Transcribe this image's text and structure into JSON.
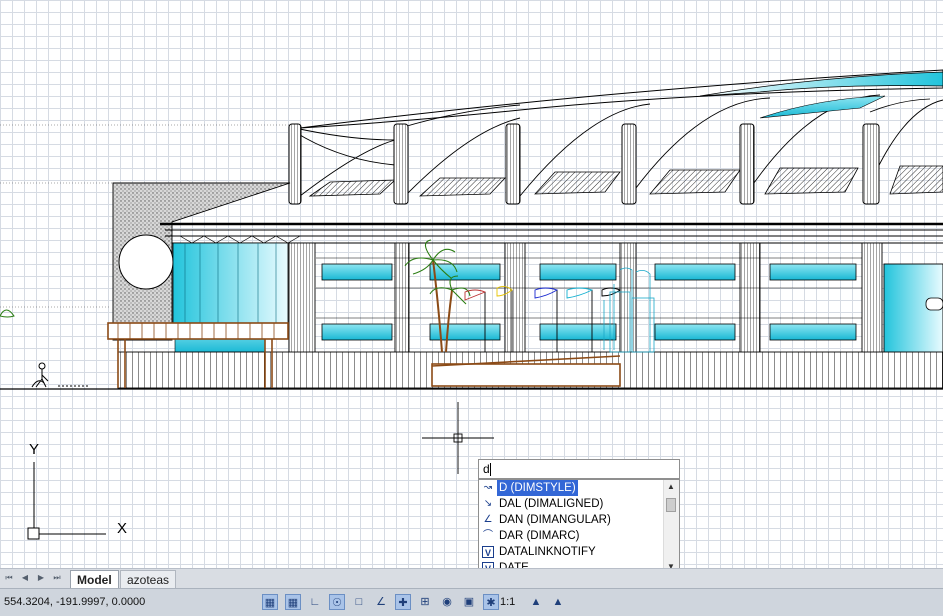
{
  "command_line": {
    "input_value": "d",
    "suggestions": [
      {
        "label": "D (DIMSTYLE)",
        "icon": "dimstyle-icon",
        "selected": true
      },
      {
        "label": "DAL (DIMALIGNED)",
        "icon": "dimaligned-icon",
        "selected": false
      },
      {
        "label": "DAN (DIMANGULAR)",
        "icon": "dimangular-icon",
        "selected": false
      },
      {
        "label": "DAR (DIMARC)",
        "icon": "dimarc-icon",
        "selected": false
      },
      {
        "label": "DATALINKNOTIFY",
        "icon": "variable-icon",
        "selected": false
      },
      {
        "label": "DATE",
        "icon": "variable-icon",
        "selected": false
      }
    ]
  },
  "ucs": {
    "x_label": "X",
    "y_label": "Y"
  },
  "layout_tabs": {
    "tabs": [
      {
        "label": "Model",
        "active": true
      },
      {
        "label": "azoteas",
        "active": false
      }
    ]
  },
  "status_bar": {
    "coordinates": "554.3204, -191.9997, 0.0000",
    "annotation_scale": "1:1",
    "toggles": [
      {
        "name": "grid-display-icon",
        "on": true
      },
      {
        "name": "snap-mode-icon",
        "on": true
      },
      {
        "name": "ortho-mode-icon",
        "on": false
      },
      {
        "name": "polar-tracking-icon",
        "on": true
      },
      {
        "name": "object-snap-icon",
        "on": false
      },
      {
        "name": "object-snap-tracking-icon",
        "on": false
      },
      {
        "name": "dynamic-ucs-icon",
        "on": true
      },
      {
        "name": "dynamic-input-icon",
        "on": false
      },
      {
        "name": "lineweight-icon",
        "on": false
      },
      {
        "name": "transparency-icon",
        "on": false
      },
      {
        "name": "selection-cycling-icon",
        "on": true
      }
    ]
  },
  "colors": {
    "grid": "#d6dbe3",
    "glass": "#22c4dc",
    "wood": "#8b4a16",
    "selection": "#3367d6"
  }
}
